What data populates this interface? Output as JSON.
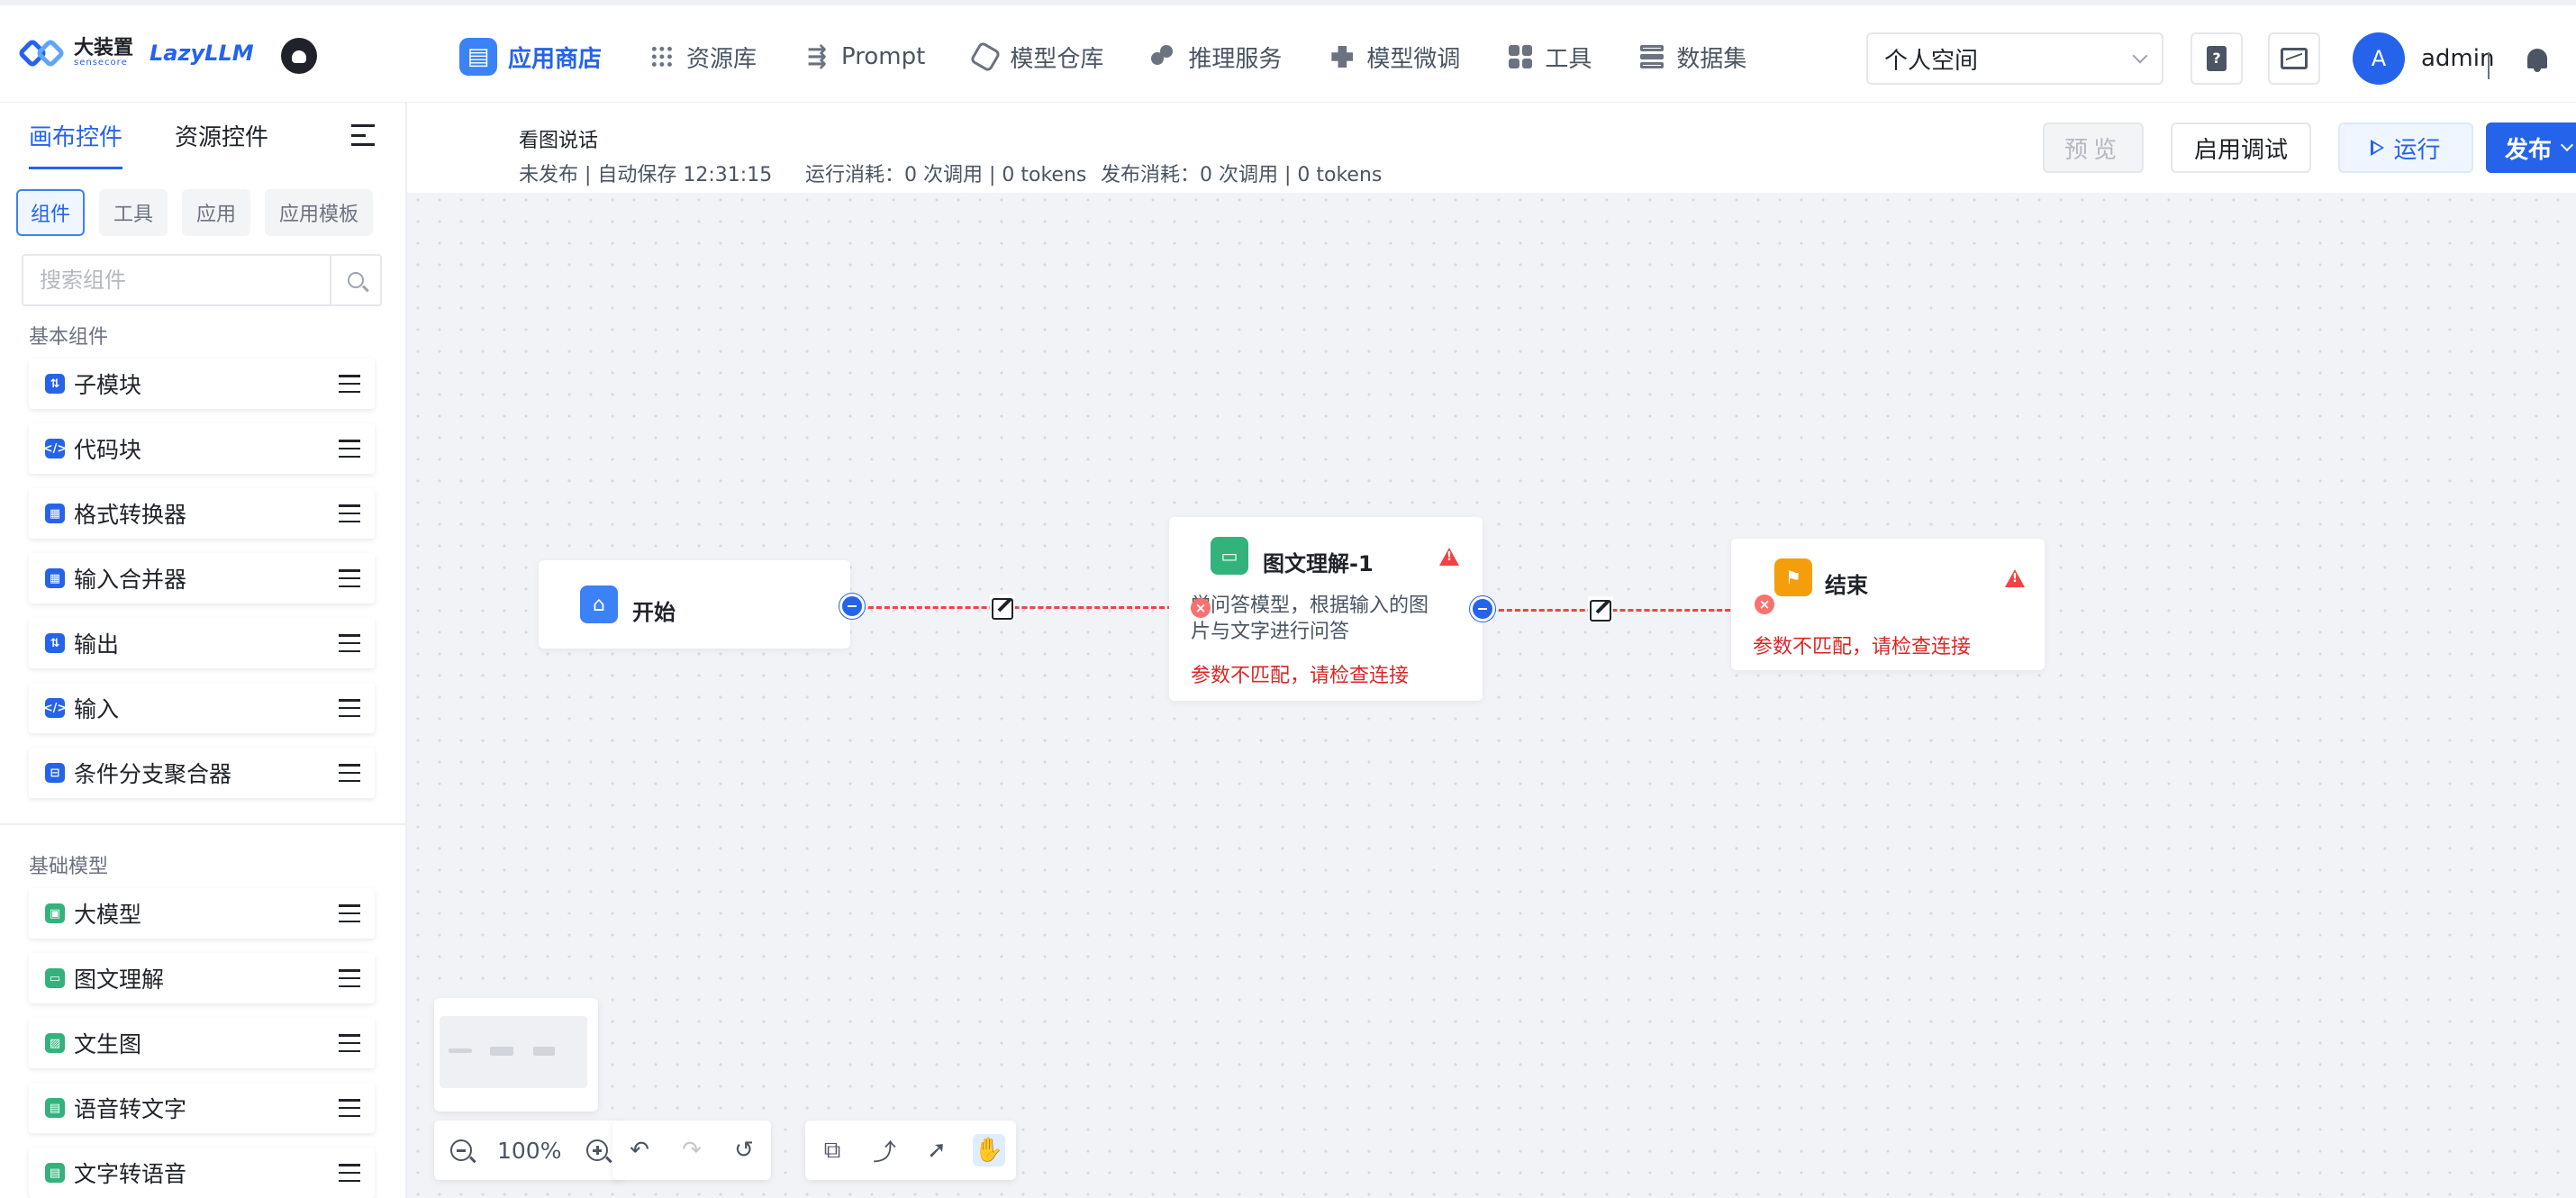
{
  "brand": {
    "logo_cn": "大装置",
    "logo_sub": "sensecore",
    "logo_en": "LazyLLM"
  },
  "nav": {
    "items": [
      {
        "label": "应用商店",
        "icon": "store-icon",
        "active": true
      },
      {
        "label": "资源库",
        "icon": "grid-icon",
        "active": false
      },
      {
        "label": "Prompt",
        "icon": "prompt-icon",
        "active": false
      },
      {
        "label": "模型仓库",
        "icon": "hexagon-icon",
        "active": false
      },
      {
        "label": "推理服务",
        "icon": "cloud-icon",
        "active": false
      },
      {
        "label": "模型微调",
        "icon": "puzzle-icon",
        "active": false
      },
      {
        "label": "工具",
        "icon": "tiles-icon",
        "active": false
      },
      {
        "label": "数据集",
        "icon": "database-icon",
        "active": false
      }
    ],
    "space": "个人空间",
    "avatar": "A",
    "user": "admin"
  },
  "sidebar": {
    "tabs": [
      "画布控件",
      "资源控件"
    ],
    "chips": [
      "组件",
      "工具",
      "应用",
      "应用模板"
    ],
    "search_placeholder": "搜索组件",
    "basic_title": "基本组件",
    "basic": [
      {
        "label": "子模块",
        "icon": "submodule-icon"
      },
      {
        "label": "代码块",
        "icon": "code-icon"
      },
      {
        "label": "格式转换器",
        "icon": "format-converter-icon"
      },
      {
        "label": "输入合并器",
        "icon": "input-merger-icon"
      },
      {
        "label": "输出",
        "icon": "output-icon"
      },
      {
        "label": "输入",
        "icon": "input-icon"
      },
      {
        "label": "条件分支聚合器",
        "icon": "branch-aggregator-icon"
      }
    ],
    "model_title": "基础模型",
    "models": [
      {
        "label": "大模型",
        "icon": "llm-icon"
      },
      {
        "label": "图文理解",
        "icon": "vqa-icon"
      },
      {
        "label": "文生图",
        "icon": "text-to-image-icon"
      },
      {
        "label": "语音转文字",
        "icon": "speech-to-text-icon"
      },
      {
        "label": "文字转语音",
        "icon": "text-to-speech-icon"
      }
    ]
  },
  "header": {
    "app_title": "看图说话",
    "status": "未发布 | 自动保存 12:31:15",
    "run_cost": "运行消耗：0 次调用 | 0 tokens",
    "publish_cost": "发布消耗：0 次调用 | 0 tokens",
    "preview": "预览",
    "debug": "启用调试",
    "run": "运行",
    "publish": "发布"
  },
  "nodes": {
    "start": {
      "title": "开始"
    },
    "vqa": {
      "title": "图文理解-1",
      "desc_line1": "觉问答模型，根据输入的图",
      "desc_line2": "片与文字进行问答",
      "error": "参数不匹配，请检查连接"
    },
    "end": {
      "title": "结束",
      "error": "参数不匹配，请检查连接"
    }
  },
  "toolbar": {
    "zoom": "100%"
  },
  "colors": {
    "primary": "#2563eb",
    "error": "#dc2626",
    "node_green": "#34b27b",
    "node_orange": "#f59e0b"
  }
}
